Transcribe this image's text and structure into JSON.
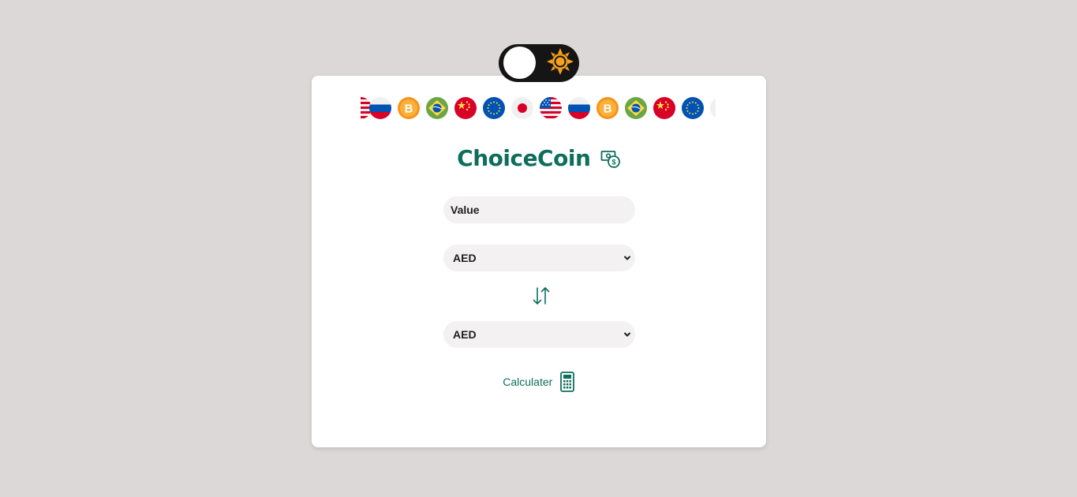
{
  "theme_toggle": {
    "state": "light",
    "icon": "sun-icon"
  },
  "carousel": {
    "flags": [
      {
        "name": "usa-flag-icon"
      },
      {
        "name": "russia-flag-icon"
      },
      {
        "name": "bitcoin-icon"
      },
      {
        "name": "brazil-flag-icon"
      },
      {
        "name": "china-flag-icon"
      },
      {
        "name": "eu-flag-icon"
      },
      {
        "name": "japan-flag-icon"
      },
      {
        "name": "usa-flag-icon"
      },
      {
        "name": "russia-flag-icon"
      },
      {
        "name": "bitcoin-icon"
      },
      {
        "name": "brazil-flag-icon"
      },
      {
        "name": "china-flag-icon"
      },
      {
        "name": "eu-flag-icon"
      },
      {
        "name": "japan-flag-icon"
      }
    ]
  },
  "app": {
    "title": "ChoiceCoin",
    "title_icon": "money-exchange-icon"
  },
  "form": {
    "value_placeholder": "Value",
    "from_currency": "AED",
    "to_currency": "AED",
    "swap_icon": "swap-arrows-icon",
    "calculate_label": "Calculater",
    "calculate_icon": "calculator-icon"
  },
  "colors": {
    "accent": "#0d6e5c",
    "background": "#dbd8d7",
    "card": "#ffffff",
    "toggle": "#151515",
    "sun": "#f7a21b"
  }
}
